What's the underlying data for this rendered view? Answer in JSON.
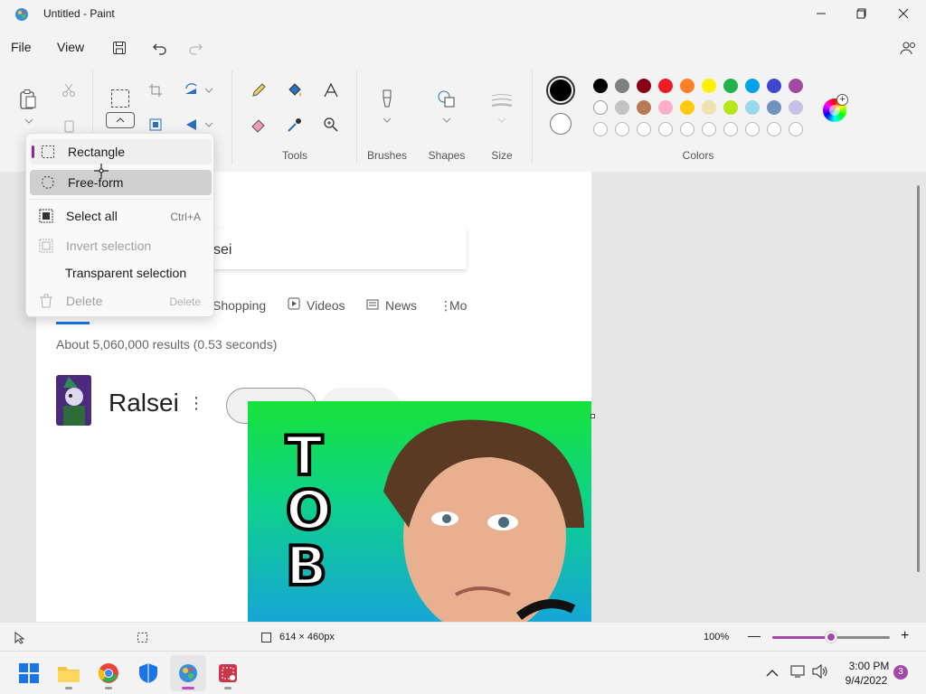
{
  "window": {
    "title": "Untitled - Paint"
  },
  "menubar": {
    "file": "File",
    "view": "View"
  },
  "ribbon": {
    "groups": {
      "tools": "Tools",
      "brushes": "Brushes",
      "shapes": "Shapes",
      "size": "Size",
      "colors": "Colors"
    }
  },
  "colors": {
    "primary": "#000000",
    "secondary": "#ffffff",
    "palette_row1": [
      "#000000",
      "#7f7f7f",
      "#880015",
      "#ed1c24",
      "#ff7f27",
      "#fff200",
      "#22b14c",
      "#00a2e8",
      "#3f48cc",
      "#a349a4"
    ],
    "palette_row2": [
      "#ffffff",
      "#c3c3c3",
      "#b97a57",
      "#ffaec9",
      "#ffc90e",
      "#efe4b0",
      "#b5e61d",
      "#99d9ea",
      "#7092be",
      "#c8bfe7"
    ]
  },
  "canvas": {
    "search_fragment": "sei",
    "tabs": [
      "Shopping",
      "Videos",
      "News",
      "Mo"
    ],
    "results_count": "About 5,060,000 results (0.53 seconds)",
    "entity_name": "Ralsei",
    "thumb_letters": [
      "T",
      "O",
      "B"
    ]
  },
  "select_menu": {
    "items": [
      {
        "label": "Rectangle"
      },
      {
        "label": "Free-form"
      },
      {
        "label": "Select all",
        "shortcut": "Ctrl+A"
      },
      {
        "label": "Invert selection"
      },
      {
        "label": "Transparent selection"
      },
      {
        "label": "Delete",
        "shortcut": "Delete"
      }
    ]
  },
  "statusbar": {
    "dimensions": "614 × 460px",
    "zoom": "100%",
    "zoom_level_percent": 100
  },
  "taskbar": {
    "time": "3:00 PM",
    "date": "9/4/2022",
    "notifications": "3"
  }
}
